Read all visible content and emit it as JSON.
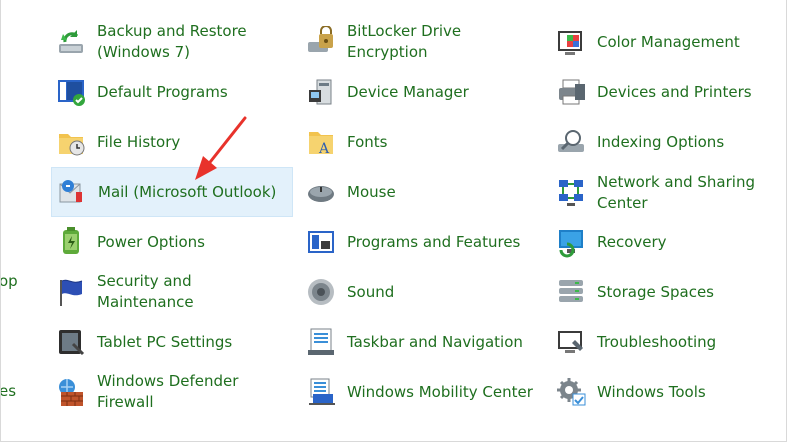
{
  "cutoff": {
    "left_text_1": "op",
    "left_text_2": "es"
  },
  "columns": [
    {
      "items": [
        {
          "label": "Backup and Restore (Windows 7)",
          "icon": "backup-restore-icon"
        },
        {
          "label": "Default Programs",
          "icon": "default-programs-icon"
        },
        {
          "label": "File History",
          "icon": "file-history-icon"
        },
        {
          "label": "Mail (Microsoft Outlook)",
          "icon": "mail-icon",
          "selected": true
        },
        {
          "label": "Power Options",
          "icon": "power-options-icon"
        },
        {
          "label": "Security and Maintenance",
          "icon": "security-flag-icon"
        },
        {
          "label": "Tablet PC Settings",
          "icon": "tablet-icon"
        },
        {
          "label": "Windows Defender Firewall",
          "icon": "firewall-icon"
        }
      ]
    },
    {
      "items": [
        {
          "label": "BitLocker Drive Encryption",
          "icon": "bitlocker-icon"
        },
        {
          "label": "Device Manager",
          "icon": "device-manager-icon"
        },
        {
          "label": "Fonts",
          "icon": "fonts-folder-icon"
        },
        {
          "label": "Mouse",
          "icon": "mouse-icon"
        },
        {
          "label": "Programs and Features",
          "icon": "programs-features-icon"
        },
        {
          "label": "Sound",
          "icon": "speaker-icon"
        },
        {
          "label": "Taskbar and Navigation",
          "icon": "taskbar-icon"
        },
        {
          "label": "Windows Mobility Center",
          "icon": "mobility-center-icon"
        }
      ]
    },
    {
      "items": [
        {
          "label": "Color Management",
          "icon": "color-management-icon"
        },
        {
          "label": "Devices and Printers",
          "icon": "printer-icon"
        },
        {
          "label": "Indexing Options",
          "icon": "indexing-icon"
        },
        {
          "label": "Network and Sharing Center",
          "icon": "network-icon"
        },
        {
          "label": "Recovery",
          "icon": "recovery-icon"
        },
        {
          "label": "Storage Spaces",
          "icon": "storage-spaces-icon"
        },
        {
          "label": "Troubleshooting",
          "icon": "troubleshooting-icon"
        },
        {
          "label": "Windows Tools",
          "icon": "windows-tools-icon"
        }
      ]
    }
  ],
  "colors": {
    "link_text": "#1f6f1f",
    "selection_bg": "#e3f1fb",
    "annotation_arrow": "#e8322b"
  },
  "annotation": {
    "icon": "red-arrow-icon"
  }
}
